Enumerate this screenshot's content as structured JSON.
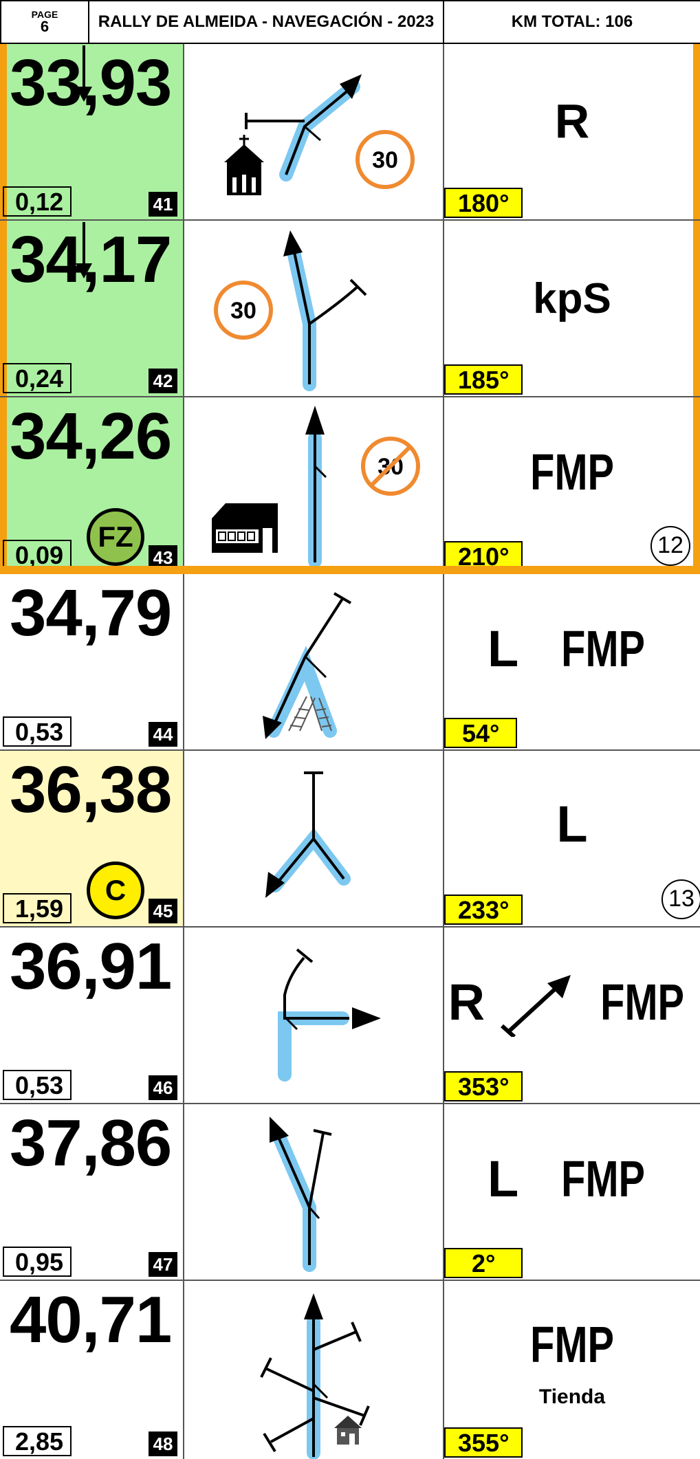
{
  "header": {
    "page_label": "PAGE",
    "page_number": "6",
    "title": "RALLY DE ALMEIDA - NAVEGACIÓN - 2023",
    "km_total": "KM TOTAL: 106"
  },
  "rows": [
    {
      "km": "33,93",
      "partial": "0,12",
      "number": "41",
      "cap": "180°",
      "instruction": "R",
      "badge": "",
      "circle": "",
      "speed": "30"
    },
    {
      "km": "34,17",
      "partial": "0,24",
      "number": "42",
      "cap": "185°",
      "instruction": "kpS",
      "badge": "",
      "circle": "",
      "speed": "30"
    },
    {
      "km": "34,26",
      "partial": "0,09",
      "number": "43",
      "cap": "210°",
      "instruction": "FMP",
      "badge": "FZ",
      "circle": "12",
      "speed": "30"
    },
    {
      "km": "34,79",
      "partial": "0,53",
      "number": "44",
      "cap": "54°",
      "instruction_l": "L",
      "instruction": "FMP"
    },
    {
      "km": "36,38",
      "partial": "1,59",
      "number": "45",
      "cap": "233°",
      "instruction": "L",
      "badge": "C",
      "circle": "13"
    },
    {
      "km": "36,91",
      "partial": "0,53",
      "number": "46",
      "cap": "353°",
      "instruction_l": "R",
      "instruction": "FMP"
    },
    {
      "km": "37,86",
      "partial": "0,95",
      "number": "47",
      "cap": "2°",
      "instruction_l": "L",
      "instruction": "FMP"
    },
    {
      "km": "40,71",
      "partial": "2,85",
      "number": "48",
      "cap": "355°",
      "instruction": "FMP",
      "note": "Tienda"
    }
  ],
  "colors": {
    "zone_green": "#aaf0a0",
    "zone_yellow": "#fff8c0",
    "zone_border": "#f5a010",
    "route": "#7cc8f0",
    "cap_bg": "#ffff00"
  }
}
